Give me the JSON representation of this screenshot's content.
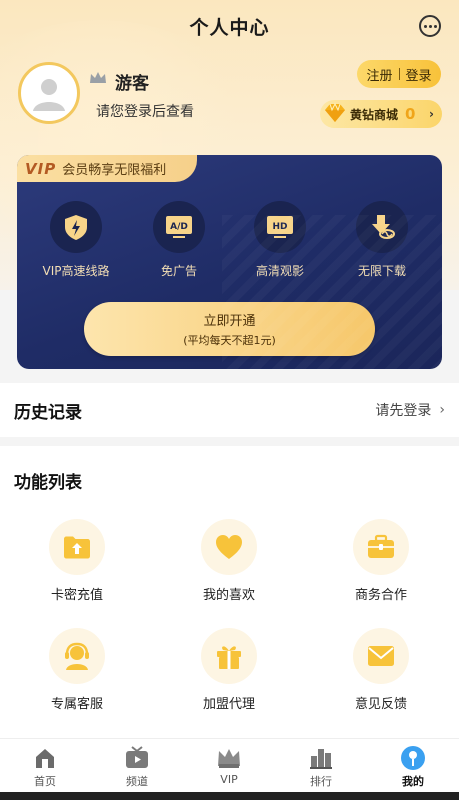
{
  "header": {
    "title": "个人中心",
    "more_icon": "more-dots-icon"
  },
  "profile": {
    "avatar_icon": "default-avatar-icon",
    "level_icon": "crown-icon",
    "username": "游客",
    "hint": "请您登录后查看",
    "register_label": "注册",
    "login_label": "登录",
    "diamond_label": "黄钻商城",
    "diamond_count": "0",
    "chevron": "›"
  },
  "vip": {
    "tag_logo": "VIP",
    "tag_text": "会员畅享无限福利",
    "perks": [
      {
        "icon": "lightning-shield-icon",
        "label": "VIP高速线路"
      },
      {
        "icon": "ad-free-icon",
        "label": "免广告",
        "badge": "A/D"
      },
      {
        "icon": "hd-screen-icon",
        "label": "高清观影",
        "badge": "HD"
      },
      {
        "icon": "unlimited-download-icon",
        "label": "无限下载"
      }
    ],
    "button_main": "立即开通",
    "button_sub": "(平均每天不超1元)"
  },
  "history": {
    "title": "历史记录",
    "link": "请先登录",
    "chevron": "›"
  },
  "features": {
    "title": "功能列表",
    "items": [
      {
        "icon": "folder-upload-icon",
        "label": "卡密充值"
      },
      {
        "icon": "heart-icon",
        "label": "我的喜欢"
      },
      {
        "icon": "briefcase-icon",
        "label": "商务合作"
      },
      {
        "icon": "headset-icon",
        "label": "专属客服"
      },
      {
        "icon": "gift-icon",
        "label": "加盟代理"
      },
      {
        "icon": "envelope-icon",
        "label": "意见反馈"
      }
    ]
  },
  "tabbar": {
    "tabs": [
      {
        "icon": "home-icon",
        "label": "首页"
      },
      {
        "icon": "tv-icon",
        "label": "频道"
      },
      {
        "icon": "vip-crown-icon",
        "label": "VIP"
      },
      {
        "icon": "ranking-icon",
        "label": "排行"
      },
      {
        "icon": "profile-icon",
        "label": "我的",
        "active": true
      }
    ]
  },
  "colors": {
    "accent_gold": "#f8c23a",
    "vip_navy": "#1f2c66",
    "perk_text": "#f4dfb5",
    "active_tab": "#3aa0f0"
  }
}
